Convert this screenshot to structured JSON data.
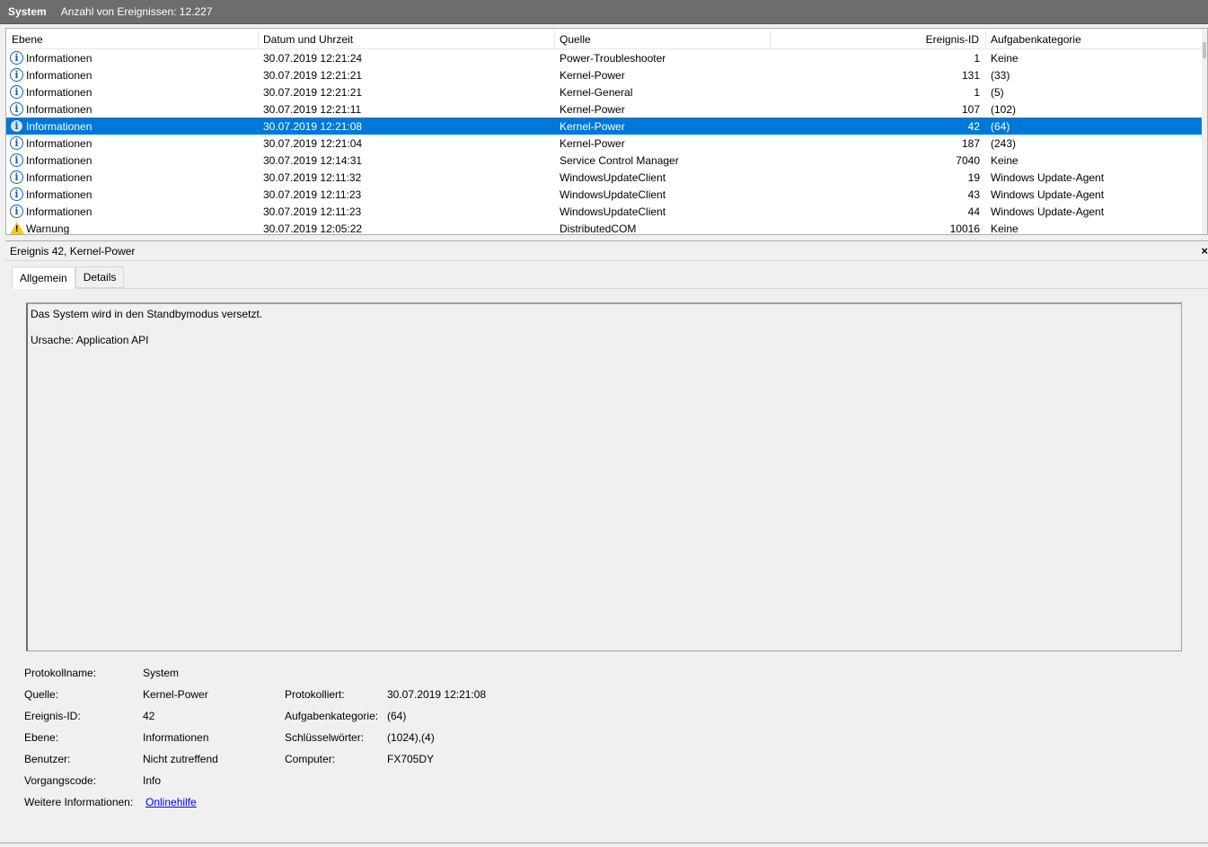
{
  "title_bar": {
    "log_name": "System",
    "event_count_label": "Anzahl von Ereignissen: 12.227"
  },
  "columns": {
    "level": "Ebene",
    "date": "Datum und Uhrzeit",
    "source": "Quelle",
    "event_id": "Ereignis-ID",
    "task": "Aufgabenkategorie"
  },
  "events": [
    {
      "icon": "info-icon",
      "level": "Informationen",
      "date": "30.07.2019 12:21:24",
      "source": "Power-Troubleshooter",
      "id": "1",
      "task": "Keine"
    },
    {
      "icon": "info-icon",
      "level": "Informationen",
      "date": "30.07.2019 12:21:21",
      "source": "Kernel-Power",
      "id": "131",
      "task": "(33)"
    },
    {
      "icon": "info-icon",
      "level": "Informationen",
      "date": "30.07.2019 12:21:21",
      "source": "Kernel-General",
      "id": "1",
      "task": "(5)"
    },
    {
      "icon": "info-icon",
      "level": "Informationen",
      "date": "30.07.2019 12:21:11",
      "source": "Kernel-Power",
      "id": "107",
      "task": "(102)"
    },
    {
      "icon": "info-icon",
      "level": "Informationen",
      "date": "30.07.2019 12:21:08",
      "source": "Kernel-Power",
      "id": "42",
      "task": "(64)",
      "selected": true
    },
    {
      "icon": "info-icon",
      "level": "Informationen",
      "date": "30.07.2019 12:21:04",
      "source": "Kernel-Power",
      "id": "187",
      "task": "(243)"
    },
    {
      "icon": "info-icon",
      "level": "Informationen",
      "date": "30.07.2019 12:14:31",
      "source": "Service Control Manager",
      "id": "7040",
      "task": "Keine"
    },
    {
      "icon": "info-icon",
      "level": "Informationen",
      "date": "30.07.2019 12:11:32",
      "source": "WindowsUpdateClient",
      "id": "19",
      "task": "Windows Update-Agent"
    },
    {
      "icon": "info-icon",
      "level": "Informationen",
      "date": "30.07.2019 12:11:23",
      "source": "WindowsUpdateClient",
      "id": "43",
      "task": "Windows Update-Agent"
    },
    {
      "icon": "info-icon",
      "level": "Informationen",
      "date": "30.07.2019 12:11:23",
      "source": "WindowsUpdateClient",
      "id": "44",
      "task": "Windows Update-Agent"
    },
    {
      "icon": "warning-icon",
      "level": "Warnung",
      "date": "30.07.2019 12:05:22",
      "source": "DistributedCOM",
      "id": "10016",
      "task": "Keine"
    }
  ],
  "detail": {
    "title": "Ereignis 42, Kernel-Power",
    "close_glyph": "×",
    "tabs": {
      "general": "Allgemein",
      "details": "Details"
    },
    "message_line1": "Das System wird in den Standbymodus versetzt.",
    "message_line2": "Ursache: Application API",
    "props": {
      "log_name_label": "Protokollname:",
      "log_name": "System",
      "source_label": "Quelle:",
      "source": "Kernel-Power",
      "logged_label": "Protokolliert:",
      "logged": "30.07.2019 12:21:08",
      "event_id_label": "Ereignis-ID:",
      "event_id": "42",
      "task_label": "Aufgabenkategorie:",
      "task": "(64)",
      "level_label": "Ebene:",
      "level": "Informationen",
      "keywords_label": "Schlüsselwörter:",
      "keywords": "(1024),(4)",
      "user_label": "Benutzer:",
      "user": "Nicht zutreffend",
      "computer_label": "Computer:",
      "computer": "FX705DY",
      "opcode_label": "Vorgangscode:",
      "opcode": "Info",
      "more_info_label": "Weitere Informationen:",
      "more_info_link": "Onlinehilfe"
    }
  }
}
